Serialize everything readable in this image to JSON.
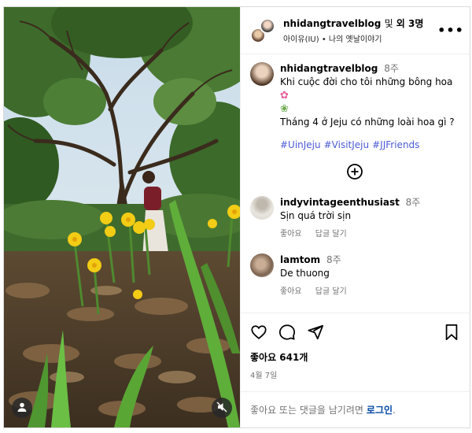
{
  "post": {
    "author": "nhidangtravelblog",
    "coauthor_joiner": "및",
    "coauthor_count": "외 3명",
    "audio": "아이유(IU) • 나의 옛날이야기",
    "more_icon": "more-horizontal-icon"
  },
  "caption": {
    "username": "nhidangtravelblog",
    "ago": "8주",
    "line1": "Khi cuộc đời cho tôi những bông hoa",
    "line2": "Tháng 4 ở Jeju có những loài hoa gì ?",
    "hashtags": [
      "#UinJeju",
      "#VisitJeju",
      "#JJFriends"
    ]
  },
  "load_more_icon": "plus-circle-icon",
  "comments": [
    {
      "username": "indyvintageenthusiast",
      "ago": "8주",
      "text": "Sịn quá trời sịn",
      "like": "좋아요",
      "reply": "답글 달기"
    },
    {
      "username": "lamtom",
      "ago": "8주",
      "text": "De thuong",
      "like": "좋아요",
      "reply": "답글 달기"
    }
  ],
  "actions": {
    "like_icon": "heart-icon",
    "comment_icon": "comment-icon",
    "share_icon": "send-icon",
    "save_icon": "bookmark-icon"
  },
  "likes_label": "좋아요 641개",
  "date": "4월 7일",
  "login_prompt": {
    "text": "좋아요 또는 댓글을 남기려면",
    "link": "로그인",
    "end": "."
  },
  "media": {
    "user_tag_icon": "person-icon",
    "mute_icon": "mute-icon"
  },
  "colors": {
    "hashtag": "#4a5bd6",
    "link": "#0047a3",
    "muted": "#737373",
    "border": "#dbdbdb"
  }
}
